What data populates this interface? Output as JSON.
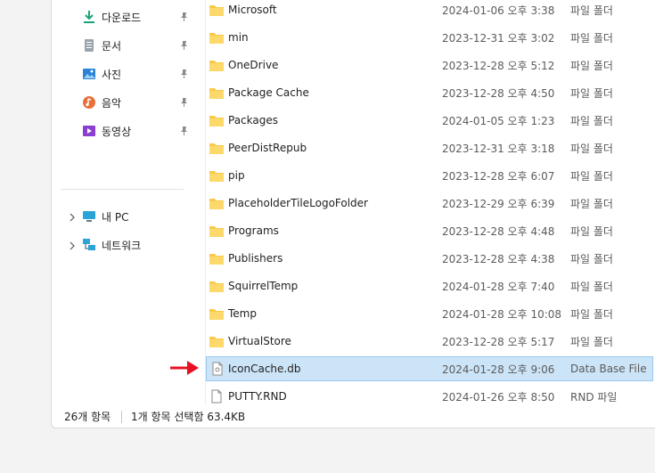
{
  "sidebar": {
    "quick": [
      {
        "label": "다운로드",
        "icon": "download-icon"
      },
      {
        "label": "문서",
        "icon": "document-icon"
      },
      {
        "label": "사진",
        "icon": "pictures-icon"
      },
      {
        "label": "음악",
        "icon": "music-icon"
      },
      {
        "label": "동영상",
        "icon": "video-icon"
      }
    ],
    "locations": [
      {
        "label": "내 PC",
        "icon": "this-pc-icon"
      },
      {
        "label": "네트워크",
        "icon": "network-icon"
      }
    ]
  },
  "files": [
    {
      "name": "Microsoft",
      "date": "2024-01-06 오후 3:38",
      "type": "파일 폴더",
      "kind": "folder"
    },
    {
      "name": "min",
      "date": "2023-12-31 오후 3:02",
      "type": "파일 폴더",
      "kind": "folder"
    },
    {
      "name": "OneDrive",
      "date": "2023-12-28 오후 5:12",
      "type": "파일 폴더",
      "kind": "folder"
    },
    {
      "name": "Package Cache",
      "date": "2023-12-28 오후 4:50",
      "type": "파일 폴더",
      "kind": "folder"
    },
    {
      "name": "Packages",
      "date": "2024-01-05 오후 1:23",
      "type": "파일 폴더",
      "kind": "folder"
    },
    {
      "name": "PeerDistRepub",
      "date": "2023-12-31 오후 3:18",
      "type": "파일 폴더",
      "kind": "folder"
    },
    {
      "name": "pip",
      "date": "2023-12-28 오후 6:07",
      "type": "파일 폴더",
      "kind": "folder"
    },
    {
      "name": "PlaceholderTileLogoFolder",
      "date": "2023-12-29 오후 6:39",
      "type": "파일 폴더",
      "kind": "folder"
    },
    {
      "name": "Programs",
      "date": "2023-12-28 오후 4:48",
      "type": "파일 폴더",
      "kind": "folder"
    },
    {
      "name": "Publishers",
      "date": "2023-12-28 오후 4:38",
      "type": "파일 폴더",
      "kind": "folder"
    },
    {
      "name": "SquirrelTemp",
      "date": "2024-01-28 오후 7:40",
      "type": "파일 폴더",
      "kind": "folder"
    },
    {
      "name": "Temp",
      "date": "2024-01-28 오후 10:08",
      "type": "파일 폴더",
      "kind": "folder"
    },
    {
      "name": "VirtualStore",
      "date": "2023-12-28 오후 5:17",
      "type": "파일 폴더",
      "kind": "folder"
    },
    {
      "name": "IconCache.db",
      "date": "2024-01-28 오후 9:06",
      "type": "Data Base File",
      "kind": "db",
      "selected": true
    },
    {
      "name": "PUTTY.RND",
      "date": "2024-01-26 오후 8:50",
      "type": "RND 파일",
      "kind": "file"
    }
  ],
  "status": {
    "count": "26개 항목",
    "selection": "1개 항목 선택함 63.4KB"
  },
  "colors": {
    "selection_bg": "#cce4f7",
    "folder": "#f8c94a",
    "arrow": "#e81123"
  }
}
